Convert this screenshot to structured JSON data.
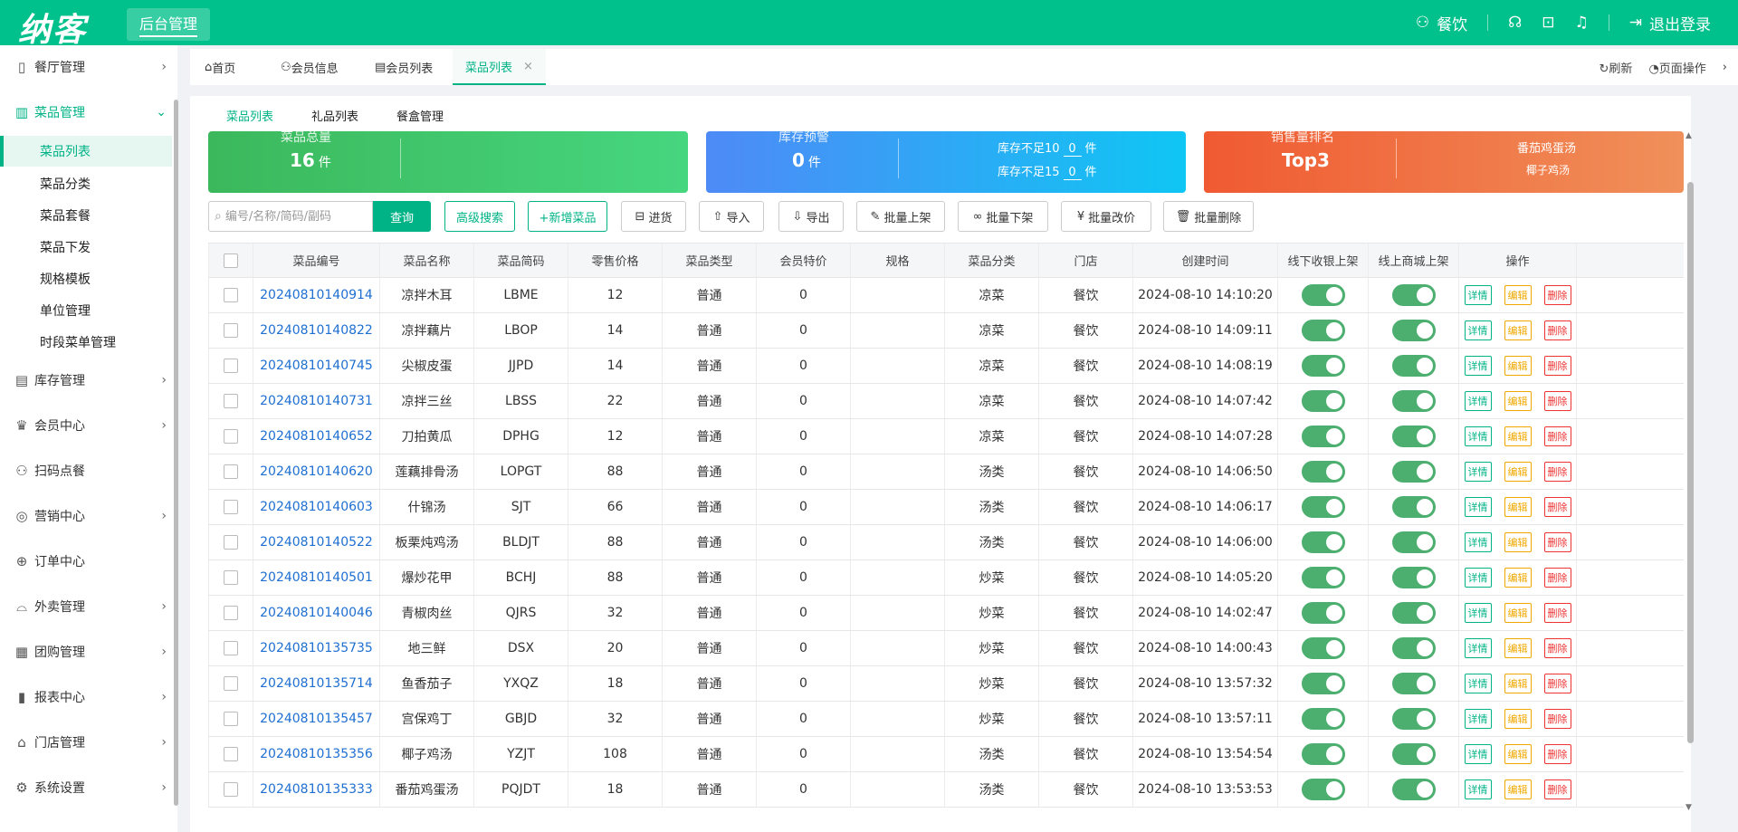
{
  "header": {
    "logo": "纳客",
    "admin_label": "后台管理",
    "user": "餐饮",
    "logout": "退出登录"
  },
  "sidebar": {
    "menus": [
      {
        "label": "餐厅管理",
        "icon": "building-icon",
        "glyph": "▯"
      },
      {
        "label": "菜品管理",
        "icon": "dish-icon",
        "glyph": "▥"
      },
      {
        "label": "库存管理",
        "icon": "inventory-icon",
        "glyph": "▤"
      },
      {
        "label": "会员中心",
        "icon": "crown-icon",
        "glyph": "♛"
      },
      {
        "label": "扫码点餐",
        "icon": "user-icon",
        "glyph": "⚇"
      },
      {
        "label": "营销中心",
        "icon": "target-icon",
        "glyph": "◎"
      },
      {
        "label": "订单中心",
        "icon": "globe-icon",
        "glyph": "⊕"
      },
      {
        "label": "外卖管理",
        "icon": "delivery-icon",
        "glyph": "⌓"
      },
      {
        "label": "团购管理",
        "icon": "calendar-icon",
        "glyph": "▦"
      },
      {
        "label": "报表中心",
        "icon": "report-icon",
        "glyph": "▮"
      },
      {
        "label": "门店管理",
        "icon": "store-icon",
        "glyph": "⌂"
      },
      {
        "label": "系统设置",
        "icon": "gear-icon",
        "glyph": "⚙"
      }
    ],
    "sub_items": [
      "菜品列表",
      "菜品分类",
      "菜品套餐",
      "菜品下发",
      "规格模板",
      "单位管理",
      "时段菜单管理"
    ]
  },
  "tabs": {
    "items": [
      {
        "label": "首页",
        "glyph": "⌂"
      },
      {
        "label": "会员信息",
        "glyph": "⚇"
      },
      {
        "label": "会员列表",
        "glyph": "▤"
      },
      {
        "label": "菜品列表",
        "glyph": ""
      }
    ],
    "refresh": "刷新",
    "page_ops": "页面操作"
  },
  "subtabs": [
    "菜品列表",
    "礼品列表",
    "餐盒管理"
  ],
  "cards": {
    "total": {
      "label": "菜品总量",
      "value": "16",
      "unit": "件"
    },
    "stock": {
      "label": "库存预警",
      "value": "0",
      "unit": "件",
      "line1_label": "库存不足10",
      "line1_value": "0",
      "line1_unit": "件",
      "line2_label": "库存不足15",
      "line2_value": "0",
      "line2_unit": "件"
    },
    "rank": {
      "label": "销售量排名",
      "value": "Top3",
      "item1": "番茄鸡蛋汤",
      "item2": "椰子鸡汤"
    }
  },
  "toolbar": {
    "search_placeholder": "编号/名称/简码/副码",
    "query": "查询",
    "advanced": "高级搜索",
    "add": "+新增菜品",
    "stock_in": "进货",
    "import": "导入",
    "export": "导出",
    "batch_on": "批量上架",
    "batch_off": "批量下架",
    "batch_price": "批量改价",
    "batch_delete": "批量删除"
  },
  "table": {
    "headers": [
      "菜品编号",
      "菜品名称",
      "菜品简码",
      "零售价格",
      "菜品类型",
      "会员特价",
      "规格",
      "菜品分类",
      "门店",
      "创建时间",
      "线下收银上架",
      "线上商城上架",
      "操作"
    ],
    "op_labels": {
      "detail": "详情",
      "edit": "编辑",
      "delete": "删除"
    },
    "rows": [
      {
        "code": "20240810140914",
        "name": "凉拌木耳",
        "abbr": "LBME",
        "price": "12",
        "type": "普通",
        "member": "0",
        "spec": "",
        "category": "凉菜",
        "store": "餐饮",
        "created": "2024-08-10 14:10:20",
        "offline_on": true,
        "online_on": true
      },
      {
        "code": "20240810140822",
        "name": "凉拌藕片",
        "abbr": "LBOP",
        "price": "14",
        "type": "普通",
        "member": "0",
        "spec": "",
        "category": "凉菜",
        "store": "餐饮",
        "created": "2024-08-10 14:09:11",
        "offline_on": true,
        "online_on": true
      },
      {
        "code": "20240810140745",
        "name": "尖椒皮蛋",
        "abbr": "JJPD",
        "price": "14",
        "type": "普通",
        "member": "0",
        "spec": "",
        "category": "凉菜",
        "store": "餐饮",
        "created": "2024-08-10 14:08:19",
        "offline_on": true,
        "online_on": true
      },
      {
        "code": "20240810140731",
        "name": "凉拌三丝",
        "abbr": "LBSS",
        "price": "22",
        "type": "普通",
        "member": "0",
        "spec": "",
        "category": "凉菜",
        "store": "餐饮",
        "created": "2024-08-10 14:07:42",
        "offline_on": true,
        "online_on": true
      },
      {
        "code": "20240810140652",
        "name": "刀拍黄瓜",
        "abbr": "DPHG",
        "price": "12",
        "type": "普通",
        "member": "0",
        "spec": "",
        "category": "凉菜",
        "store": "餐饮",
        "created": "2024-08-10 14:07:28",
        "offline_on": true,
        "online_on": true
      },
      {
        "code": "20240810140620",
        "name": "莲藕排骨汤",
        "abbr": "LOPGT",
        "price": "88",
        "type": "普通",
        "member": "0",
        "spec": "",
        "category": "汤类",
        "store": "餐饮",
        "created": "2024-08-10 14:06:50",
        "offline_on": true,
        "online_on": true
      },
      {
        "code": "20240810140603",
        "name": "什锦汤",
        "abbr": "SJT",
        "price": "66",
        "type": "普通",
        "member": "0",
        "spec": "",
        "category": "汤类",
        "store": "餐饮",
        "created": "2024-08-10 14:06:17",
        "offline_on": true,
        "online_on": true
      },
      {
        "code": "20240810140522",
        "name": "板栗炖鸡汤",
        "abbr": "BLDJT",
        "price": "88",
        "type": "普通",
        "member": "0",
        "spec": "",
        "category": "汤类",
        "store": "餐饮",
        "created": "2024-08-10 14:06:00",
        "offline_on": true,
        "online_on": true
      },
      {
        "code": "20240810140501",
        "name": "爆炒花甲",
        "abbr": "BCHJ",
        "price": "88",
        "type": "普通",
        "member": "0",
        "spec": "",
        "category": "炒菜",
        "store": "餐饮",
        "created": "2024-08-10 14:05:20",
        "offline_on": true,
        "online_on": true
      },
      {
        "code": "20240810140046",
        "name": "青椒肉丝",
        "abbr": "QJRS",
        "price": "32",
        "type": "普通",
        "member": "0",
        "spec": "",
        "category": "炒菜",
        "store": "餐饮",
        "created": "2024-08-10 14:02:47",
        "offline_on": true,
        "online_on": true
      },
      {
        "code": "20240810135735",
        "name": "地三鲜",
        "abbr": "DSX",
        "price": "20",
        "type": "普通",
        "member": "0",
        "spec": "",
        "category": "炒菜",
        "store": "餐饮",
        "created": "2024-08-10 14:00:43",
        "offline_on": true,
        "online_on": true
      },
      {
        "code": "20240810135714",
        "name": "鱼香茄子",
        "abbr": "YXQZ",
        "price": "18",
        "type": "普通",
        "member": "0",
        "spec": "",
        "category": "炒菜",
        "store": "餐饮",
        "created": "2024-08-10 13:57:32",
        "offline_on": true,
        "online_on": true
      },
      {
        "code": "20240810135457",
        "name": "宫保鸡丁",
        "abbr": "GBJD",
        "price": "32",
        "type": "普通",
        "member": "0",
        "spec": "",
        "category": "炒菜",
        "store": "餐饮",
        "created": "2024-08-10 13:57:11",
        "offline_on": true,
        "online_on": true
      },
      {
        "code": "20240810135356",
        "name": "椰子鸡汤",
        "abbr": "YZJT",
        "price": "108",
        "type": "普通",
        "member": "0",
        "spec": "",
        "category": "汤类",
        "store": "餐饮",
        "created": "2024-08-10 13:54:54",
        "offline_on": true,
        "online_on": true
      },
      {
        "code": "20240810135333",
        "name": "番茄鸡蛋汤",
        "abbr": "PQJDT",
        "price": "18",
        "type": "普通",
        "member": "0",
        "spec": "",
        "category": "汤类",
        "store": "餐饮",
        "created": "2024-08-10 13:53:53",
        "offline_on": true,
        "online_on": true
      }
    ]
  },
  "colors": {
    "brand": "#00c08b",
    "accent": "#00b386",
    "link": "#1f6fd1",
    "toggle_on": "#4caf70"
  }
}
